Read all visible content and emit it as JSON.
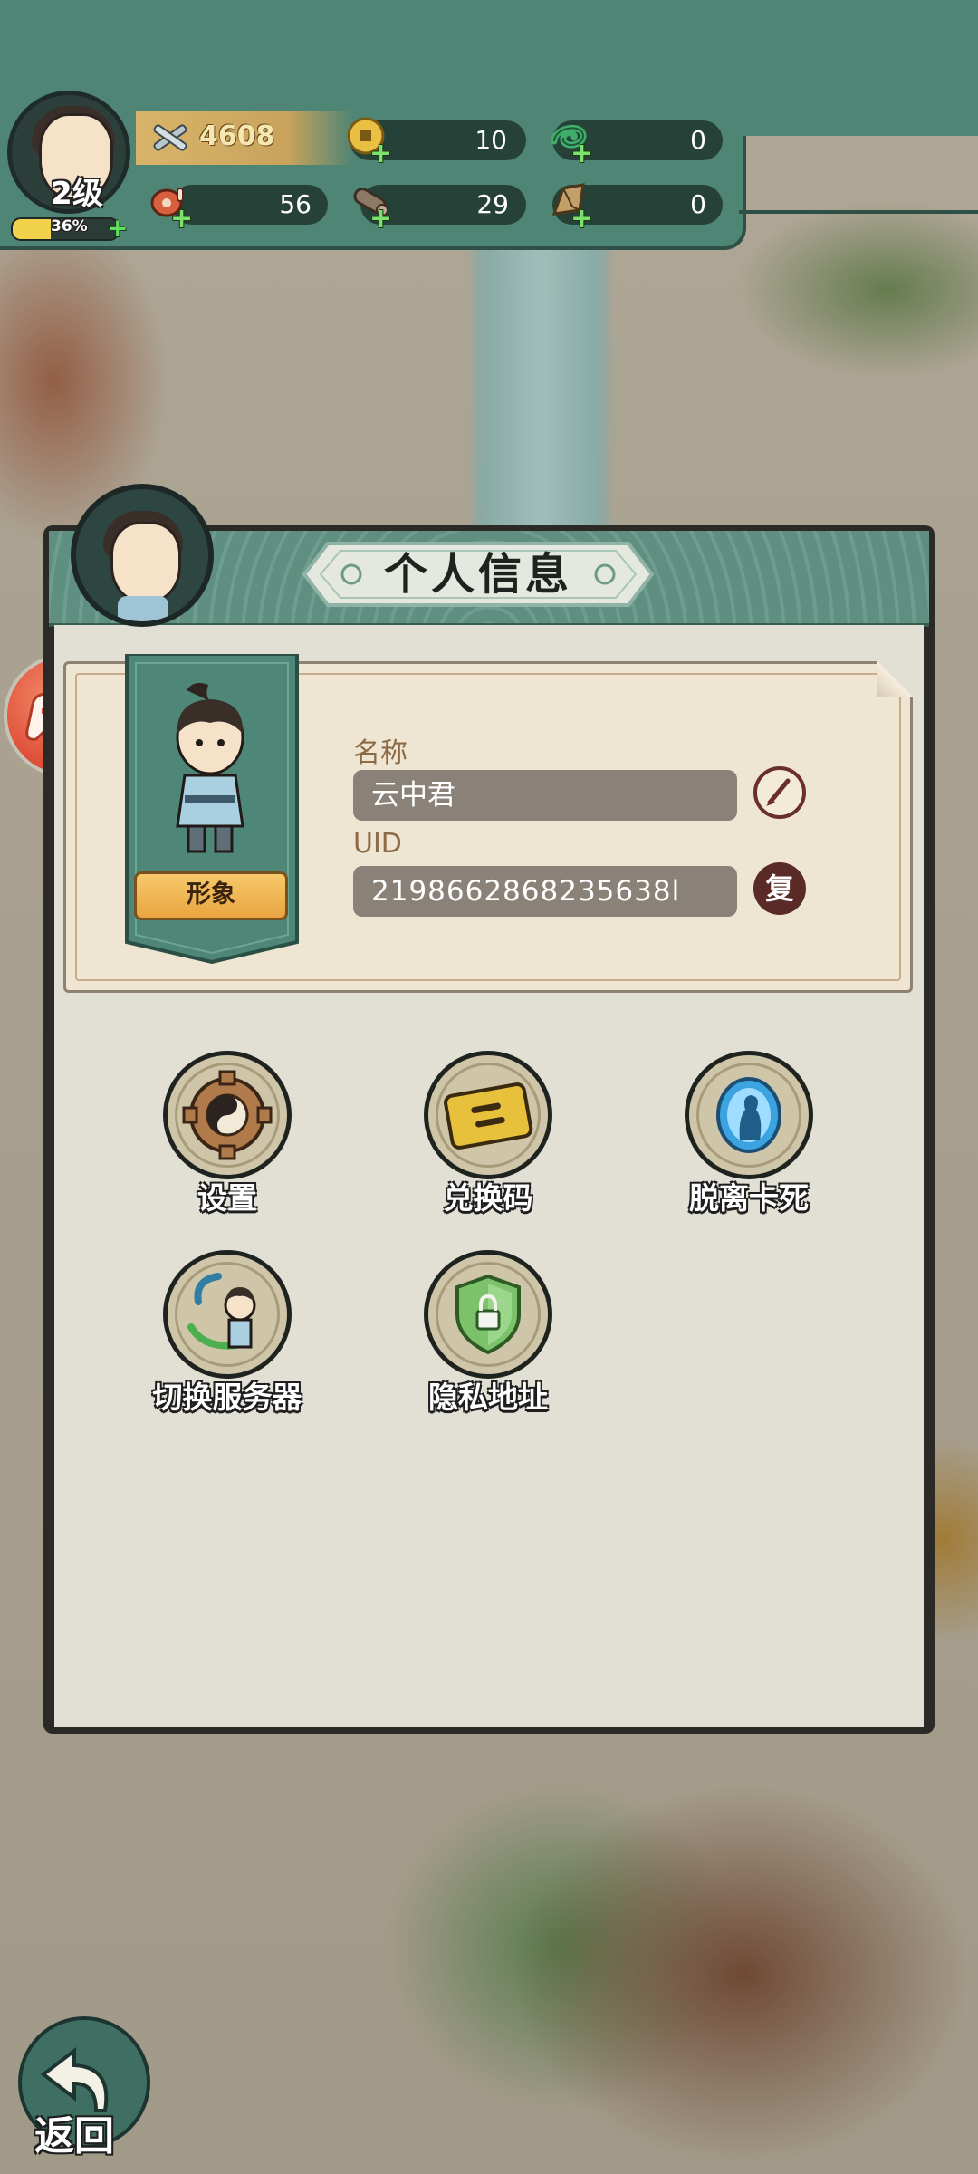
{
  "player": {
    "level_label": "2级",
    "xp_percent_text": "36%",
    "xp_fraction": 0.36,
    "power": "4608"
  },
  "resources": [
    {
      "name": "copper-coin",
      "value": "10"
    },
    {
      "name": "jade-dragon",
      "value": "0"
    },
    {
      "name": "meat",
      "value": "56"
    },
    {
      "name": "wood",
      "value": "29"
    },
    {
      "name": "stone",
      "value": "0"
    }
  ],
  "panel": {
    "title": "个人信息",
    "look_label": "形象",
    "name_label": "名称",
    "name_value": "云中君",
    "uid_label": "UID",
    "uid_value": "2198662868235638l",
    "copy_label": "复"
  },
  "menu": [
    {
      "label": "设置",
      "icon": "settings-gear-icon"
    },
    {
      "label": "兑换码",
      "icon": "redeem-code-icon"
    },
    {
      "label": "脱离卡死",
      "icon": "unstuck-portal-icon"
    },
    {
      "label": "切换服务器",
      "icon": "switch-server-icon"
    },
    {
      "label": "隐私地址",
      "icon": "privacy-shield-icon"
    }
  ],
  "back_label": "返回",
  "colors": {
    "theme_green": "#4f8575",
    "panel_body": "#e2e0d4",
    "accent_orange": "#e9a541"
  }
}
